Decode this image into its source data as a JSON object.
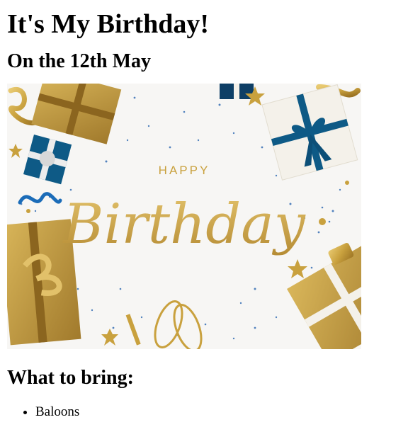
{
  "header": {
    "title": "It's My Birthday!",
    "date": "On the 12th May"
  },
  "hero_image": {
    "small_text": "HAPPY",
    "script_text": "Birthday",
    "colors": {
      "background": "#f7f6f4",
      "gold": "#c9a13e",
      "gold_dark": "#a47b25",
      "blue": "#0e5a86",
      "ribbon_white": "#f4f1ea"
    }
  },
  "bring_section": {
    "heading": "What to bring:",
    "items": [
      "Baloons"
    ]
  }
}
